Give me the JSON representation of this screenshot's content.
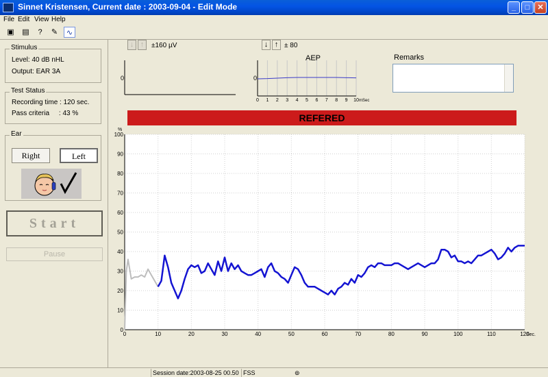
{
  "window": {
    "title": "Sinnet Kristensen, Current date : 2003-09-04 - Edit Mode"
  },
  "window_buttons": {
    "minimize": "_",
    "maximize": "□",
    "close": "✕"
  },
  "menu": [
    "File",
    "Edit",
    "View",
    "Help"
  ],
  "toolbar": {
    "icons": [
      "save-icon",
      "print-icon",
      "help-icon",
      "edit-notes-icon",
      "waveform-icon"
    ],
    "glyphs": {
      "save": "▣",
      "print": "▤",
      "help": "?",
      "edit": "✎",
      "wave": "∿"
    }
  },
  "stimulus": {
    "title": "Stimulus",
    "level": "Level: 40 dB nHL",
    "output": "Output: EAR 3A"
  },
  "test_status": {
    "title": "Test Status",
    "recording_time": "Recording time : 120 sec.",
    "pass_criteria": "Pass criteria     : 43 %"
  },
  "ear": {
    "title": "Ear",
    "right": "Right",
    "left": "Left",
    "selected": "Left"
  },
  "controls": {
    "start": "Start",
    "pause": "Pause"
  },
  "eeg_panel": {
    "scale": "±160 µV",
    "zero": "0"
  },
  "aep_panel": {
    "scale": "± 80",
    "title": "AEP",
    "zero": "0",
    "x_ticks": [
      "0",
      "1",
      "2",
      "3",
      "4",
      "5",
      "6",
      "7",
      "8",
      "9",
      "10"
    ],
    "x_unit": "mSec",
    "waveform": {
      "x": [
        0,
        1,
        2,
        3,
        4,
        5,
        6,
        7,
        8,
        9,
        10
      ],
      "y": [
        -3,
        -2,
        0,
        2,
        3,
        3,
        3,
        3,
        3,
        2,
        1
      ]
    }
  },
  "remarks": {
    "label": "Remarks",
    "value": ""
  },
  "result_banner": {
    "text": "REFERED",
    "color": "#cc1b1b"
  },
  "chart_data": {
    "type": "line",
    "ylabel": "%",
    "xlim": [
      0,
      120
    ],
    "ylim": [
      0,
      100
    ],
    "x_ticks": [
      "0",
      "10",
      "20",
      "30",
      "40",
      "50",
      "60",
      "70",
      "80",
      "90",
      "100",
      "110",
      "120"
    ],
    "x_unit": "Sec.",
    "y_ticks": [
      "0",
      "10",
      "20",
      "30",
      "40",
      "50",
      "60",
      "70",
      "80",
      "90",
      "100"
    ],
    "grid": true,
    "series": [
      {
        "color": "#bdbdbd",
        "x": [
          0,
          0.5,
          1,
          1.5,
          2,
          3,
          4,
          5,
          6,
          7,
          8,
          9,
          10
        ],
        "y": [
          0,
          30,
          36,
          31,
          26,
          27,
          27,
          28,
          27,
          31,
          28,
          25,
          22
        ]
      },
      {
        "color": "#1414d2",
        "x": [
          10,
          11,
          12,
          13,
          14,
          15,
          16,
          17,
          18,
          19,
          20,
          21,
          22,
          23,
          24,
          25,
          26,
          27,
          28,
          29,
          30,
          31,
          32,
          33,
          34,
          35,
          36,
          37,
          38,
          39,
          40,
          41,
          42,
          43,
          44,
          45,
          46,
          47,
          48,
          49,
          50,
          51,
          52,
          53,
          54,
          55,
          56,
          57,
          58,
          59,
          60,
          61,
          62,
          63,
          64,
          65,
          66,
          67,
          68,
          69,
          70,
          71,
          72,
          73,
          74,
          75,
          76,
          77,
          78,
          79,
          80,
          81,
          82,
          83,
          84,
          85,
          86,
          87,
          88,
          89,
          90,
          91,
          92,
          93,
          94,
          95,
          96,
          97,
          98,
          99,
          100,
          101,
          102,
          103,
          104,
          105,
          106,
          107,
          108,
          109,
          110,
          111,
          112,
          113,
          114,
          115,
          116,
          117,
          118,
          119,
          120
        ],
        "y": [
          22,
          25,
          38,
          32,
          24,
          20,
          16,
          20,
          26,
          31,
          33,
          32,
          33,
          29,
          30,
          34,
          31,
          28,
          35,
          30,
          37,
          30,
          34,
          31,
          33,
          30,
          29,
          28,
          28,
          29,
          30,
          31,
          27,
          32,
          34,
          30,
          29,
          27,
          26,
          24,
          28,
          32,
          31,
          28,
          24,
          22,
          22,
          22,
          21,
          20,
          19,
          18,
          20,
          18,
          21,
          22,
          24,
          23,
          26,
          24,
          28,
          27,
          29,
          32,
          33,
          32,
          34,
          34,
          33,
          33,
          33,
          34,
          34,
          33,
          32,
          31,
          32,
          33,
          34,
          33,
          32,
          33,
          34,
          34,
          36,
          41,
          41,
          40,
          37,
          38,
          35,
          35,
          34,
          35,
          34,
          36,
          38,
          38,
          39,
          40,
          41,
          39,
          36,
          37,
          39,
          42,
          40,
          42,
          43,
          43,
          43
        ]
      }
    ]
  },
  "status_bar": {
    "session_date": "Session date:2003-08-25 00.50",
    "mode": "FSS",
    "icon": "network-icon"
  }
}
